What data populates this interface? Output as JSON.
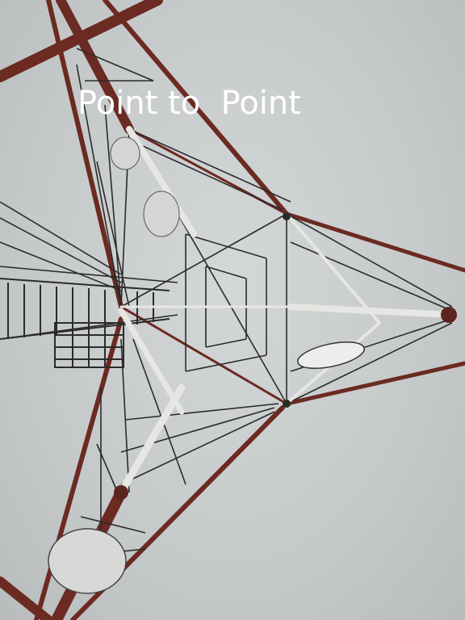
{
  "caption": {
    "text": "Point to  Point"
  },
  "colors": {
    "sky": "#c9cccd",
    "steel_red": "#6e2a22",
    "steel_white": "#e8e8e6",
    "steel_dark": "#2a2a2a",
    "caption": "#ffffff"
  }
}
